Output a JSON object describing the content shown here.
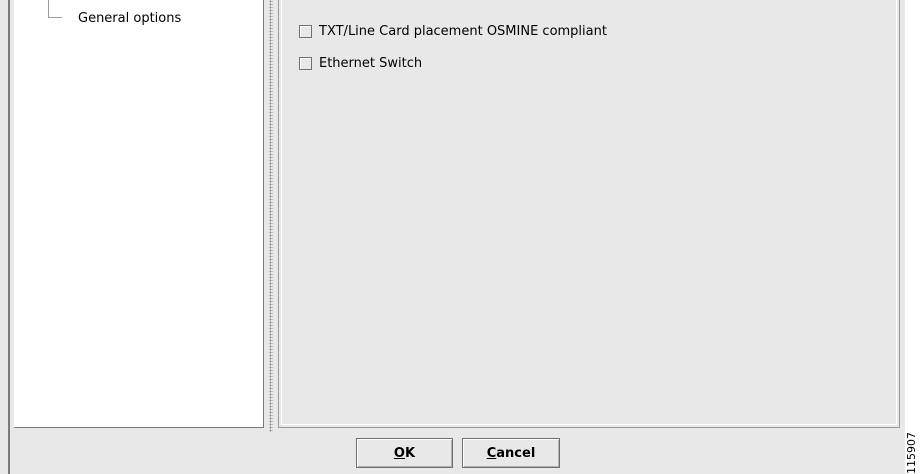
{
  "tree": {
    "items": [
      {
        "label": "General options"
      }
    ]
  },
  "options": [
    {
      "label": "TXT/Line Card placement OSMINE compliant",
      "checked": false
    },
    {
      "label": "Ethernet Switch",
      "checked": false
    }
  ],
  "buttons": {
    "ok": {
      "mnemonic": "O",
      "rest": "K"
    },
    "cancel": {
      "mnemonic": "C",
      "rest": "ancel"
    }
  },
  "figure_id": "115907"
}
